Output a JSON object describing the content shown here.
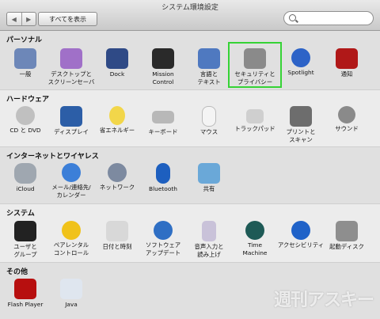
{
  "window": {
    "title": "システム環境設定",
    "show_all": "すべてを表示",
    "nav_back": "◀",
    "nav_forward": "▶"
  },
  "search": {
    "placeholder": ""
  },
  "sections": [
    {
      "title": "パーソナル",
      "items": [
        {
          "label": "一般",
          "icon": "general-icon",
          "color": "#6d87b8"
        },
        {
          "label": "デスクトップと\nスクリーンセーバ",
          "icon": "desktop-screensaver-icon",
          "color": "#a070c8"
        },
        {
          "label": "Dock",
          "icon": "dock-icon",
          "color": "#2f4a86"
        },
        {
          "label": "Mission\nControl",
          "icon": "mission-control-icon",
          "color": "#2a2a2a"
        },
        {
          "label": "言語と\nテキスト",
          "icon": "language-text-icon",
          "color": "#4f79c0"
        },
        {
          "label": "セキュリティと\nプライバシー",
          "icon": "security-privacy-icon",
          "color": "#8a8a8a"
        },
        {
          "label": "Spotlight",
          "icon": "spotlight-icon",
          "color": "#2d63c7"
        },
        {
          "label": "通知",
          "icon": "notifications-icon",
          "color": "#b01818"
        }
      ]
    },
    {
      "title": "ハードウェア",
      "items": [
        {
          "label": "CD と DVD",
          "icon": "cd-dvd-icon",
          "color": "#c0c0c0"
        },
        {
          "label": "ディスプレイ",
          "icon": "display-icon",
          "color": "#2c5ea7"
        },
        {
          "label": "省エネルギー",
          "icon": "energy-saver-icon",
          "color": "#f2d64a"
        },
        {
          "label": "キーボード",
          "icon": "keyboard-icon",
          "color": "#b8b8b8"
        },
        {
          "label": "マウス",
          "icon": "mouse-icon",
          "color": "#f4f4f4"
        },
        {
          "label": "トラックパッド",
          "icon": "trackpad-icon",
          "color": "#cfcfcf"
        },
        {
          "label": "プリントと\nスキャン",
          "icon": "print-scan-icon",
          "color": "#6d6d6d"
        },
        {
          "label": "サウンド",
          "icon": "sound-icon",
          "color": "#8a8a8a"
        }
      ]
    },
    {
      "title": "インターネットとワイヤレス",
      "items": [
        {
          "label": "iCloud",
          "icon": "icloud-icon",
          "color": "#9fa7b0"
        },
        {
          "label": "メール/連絡先/\nカレンダー",
          "icon": "mail-contacts-calendar-icon",
          "color": "#3c7fd8"
        },
        {
          "label": "ネットワーク",
          "icon": "network-icon",
          "color": "#7d8aa0"
        },
        {
          "label": "Bluetooth",
          "icon": "bluetooth-icon",
          "color": "#1d5fbf"
        },
        {
          "label": "共有",
          "icon": "sharing-icon",
          "color": "#6aa8d8"
        }
      ]
    },
    {
      "title": "システム",
      "items": [
        {
          "label": "ユーザと\nグループ",
          "icon": "users-groups-icon",
          "color": "#222222"
        },
        {
          "label": "ペアレンタル\nコントロール",
          "icon": "parental-controls-icon",
          "color": "#f0c21a"
        },
        {
          "label": "日付と時刻",
          "icon": "date-time-icon",
          "color": "#d8d8d8"
        },
        {
          "label": "ソフトウェア\nアップデート",
          "icon": "software-update-icon",
          "color": "#2f6fc4"
        },
        {
          "label": "音声入力と\n読み上げ",
          "icon": "dictation-speech-icon",
          "color": "#c9c2d9"
        },
        {
          "label": "Time\nMachine",
          "icon": "time-machine-icon",
          "color": "#1e5a56"
        },
        {
          "label": "アクセシビリティ",
          "icon": "accessibility-icon",
          "color": "#1f62c8"
        },
        {
          "label": "起動ディスク",
          "icon": "startup-disk-icon",
          "color": "#8e8e8e"
        }
      ]
    },
    {
      "title": "その他",
      "items": [
        {
          "label": "Flash Player",
          "icon": "flash-player-icon",
          "color": "#b70f0f"
        },
        {
          "label": "Java",
          "icon": "java-icon",
          "color": "#dfe6ef"
        }
      ]
    }
  ],
  "watermark": "週刊アスキー"
}
